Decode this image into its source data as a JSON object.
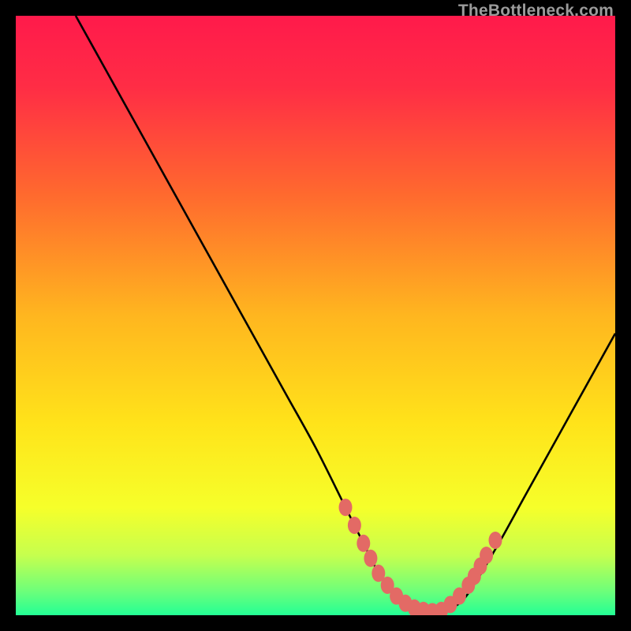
{
  "watermark": "TheBottleneck.com",
  "chart_data": {
    "type": "line",
    "title": "",
    "xlabel": "",
    "ylabel": "",
    "xlim": [
      0,
      100
    ],
    "ylim": [
      0,
      100
    ],
    "series": [
      {
        "name": "curve",
        "x": [
          10,
          15,
          20,
          25,
          30,
          35,
          40,
          45,
          50,
          55,
          58,
          60,
          62,
          65,
          68,
          70,
          72,
          75,
          80,
          85,
          90,
          95,
          100
        ],
        "y": [
          100,
          91,
          82,
          73,
          64,
          55,
          46,
          37,
          28,
          18,
          12,
          8,
          5,
          2,
          1,
          0.5,
          1,
          3,
          11,
          20,
          29,
          38,
          47
        ]
      }
    ],
    "markers": {
      "name": "highlight-points",
      "color": "#e36a65",
      "points": [
        {
          "x": 55.0,
          "y": 18.0
        },
        {
          "x": 56.5,
          "y": 15.0
        },
        {
          "x": 58.0,
          "y": 12.0
        },
        {
          "x": 59.2,
          "y": 9.5
        },
        {
          "x": 60.5,
          "y": 7.0
        },
        {
          "x": 62.0,
          "y": 5.0
        },
        {
          "x": 63.5,
          "y": 3.2
        },
        {
          "x": 65.0,
          "y": 2.0
        },
        {
          "x": 66.5,
          "y": 1.2
        },
        {
          "x": 68.0,
          "y": 0.8
        },
        {
          "x": 69.5,
          "y": 0.6
        },
        {
          "x": 71.0,
          "y": 0.8
        },
        {
          "x": 72.5,
          "y": 1.8
        },
        {
          "x": 74.0,
          "y": 3.2
        },
        {
          "x": 75.5,
          "y": 5.0
        },
        {
          "x": 76.5,
          "y": 6.5
        },
        {
          "x": 77.5,
          "y": 8.2
        },
        {
          "x": 78.5,
          "y": 10.0
        },
        {
          "x": 80.0,
          "y": 12.5
        }
      ]
    },
    "gradient": {
      "stops": [
        {
          "offset": 0.0,
          "color": "#ff1a4b"
        },
        {
          "offset": 0.12,
          "color": "#ff2d45"
        },
        {
          "offset": 0.3,
          "color": "#ff6a2e"
        },
        {
          "offset": 0.5,
          "color": "#ffb61f"
        },
        {
          "offset": 0.68,
          "color": "#ffe31a"
        },
        {
          "offset": 0.82,
          "color": "#f6ff2a"
        },
        {
          "offset": 0.9,
          "color": "#c6ff4e"
        },
        {
          "offset": 0.96,
          "color": "#6dff7a"
        },
        {
          "offset": 1.0,
          "color": "#23ff95"
        }
      ]
    }
  }
}
